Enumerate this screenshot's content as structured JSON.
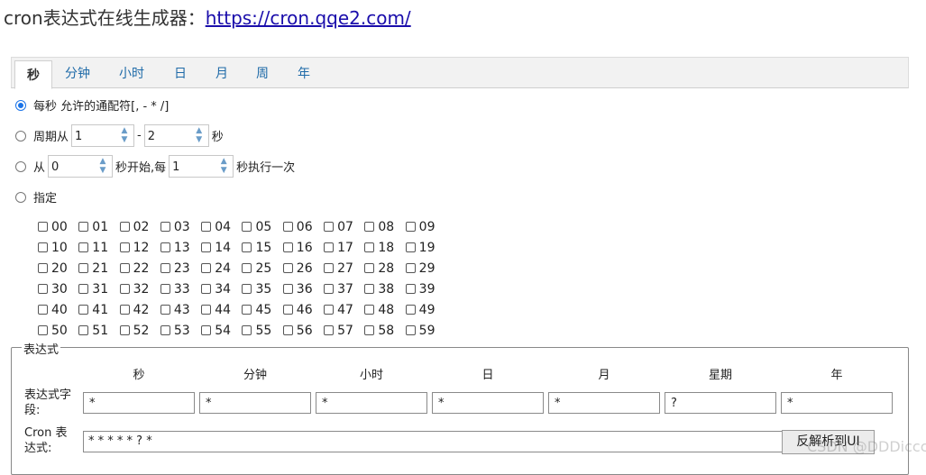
{
  "header": {
    "label": "cron表达式在线生成器：",
    "link": "https://cron.qqe2.com/"
  },
  "tabs": [
    {
      "label": "秒",
      "active": true
    },
    {
      "label": "分钟"
    },
    {
      "label": "小时"
    },
    {
      "label": "日"
    },
    {
      "label": "月"
    },
    {
      "label": "周"
    },
    {
      "label": "年"
    }
  ],
  "options": {
    "every": {
      "label": "每秒 允许的通配符[, - * /]"
    },
    "period": {
      "prefix": "周期从",
      "from": "1",
      "sep": "-",
      "to": "2",
      "suffix": "秒"
    },
    "start": {
      "prefix": "从",
      "start": "0",
      "mid": "秒开始,每",
      "step": "1",
      "suffix": "秒执行一次"
    },
    "specify": {
      "label": "指定"
    }
  },
  "seconds": [
    "00",
    "01",
    "02",
    "03",
    "04",
    "05",
    "06",
    "07",
    "08",
    "09",
    "10",
    "11",
    "12",
    "13",
    "14",
    "15",
    "16",
    "17",
    "18",
    "19",
    "20",
    "21",
    "22",
    "23",
    "24",
    "25",
    "26",
    "27",
    "28",
    "29",
    "30",
    "31",
    "32",
    "33",
    "34",
    "35",
    "36",
    "37",
    "38",
    "39",
    "40",
    "41",
    "42",
    "43",
    "44",
    "45",
    "46",
    "47",
    "48",
    "49",
    "50",
    "51",
    "52",
    "53",
    "54",
    "55",
    "56",
    "57",
    "58",
    "59"
  ],
  "expression": {
    "legend": "表达式",
    "columns": [
      "秒",
      "分钟",
      "小时",
      "日",
      "月",
      "星期",
      "年"
    ],
    "fields_label": "表达式字段:",
    "values": [
      "*",
      "*",
      "*",
      "*",
      "*",
      "?",
      "*"
    ],
    "cron_label": "Cron 表达式:",
    "cron_value": "* * * * * ? *",
    "parse_button": "反解析到UI"
  },
  "watermark": "CSDN @DDDiccc"
}
